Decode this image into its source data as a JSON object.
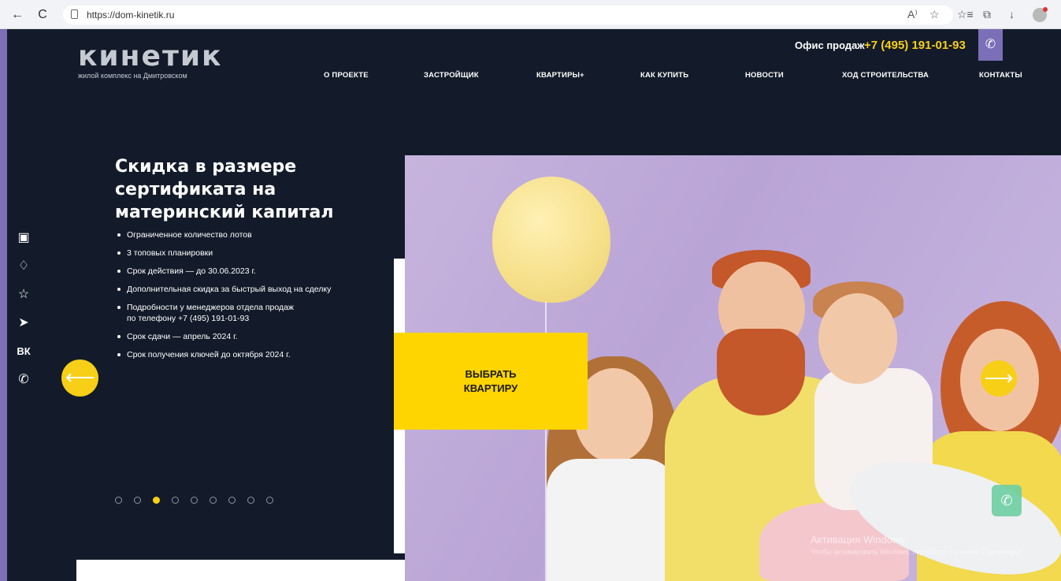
{
  "browser": {
    "back_icon": "←",
    "refresh_icon": "C",
    "url": "https://dom-kinetik.ru",
    "toolbar_icons": [
      "A⁾",
      "☆",
      "☆≡",
      "⧉",
      "↓"
    ]
  },
  "header": {
    "logo_word": "кинетик",
    "logo_subtitle": "жилой комплекс на Дмитровском",
    "office_label": "Офис продаж",
    "office_phone": "+7 (495) 191-01-93",
    "phone_icon": "✆"
  },
  "menu": [
    "О ПРОЕКТЕ",
    "ЗАСТРОЙЩИК",
    "КВАРТИРЫ+",
    "КАК КУПИТЬ",
    "НОВОСТИ",
    "ХОД СТРОИТЕЛЬСТВА",
    "КОНТАКТЫ"
  ],
  "side_icons": [
    "▣",
    "♢",
    "☆",
    "➤",
    "ВК",
    "✆"
  ],
  "slide": {
    "title": "Скидка в размере сертификата на материнский капитал",
    "features": [
      "Ограниченное количество лотов",
      "3 топовых планировки",
      "Срок действия — до 30.06.2023 г.",
      "Дополнительная скидка за быстрый выход на сделку",
      "Подробности у менеджеров отдела продаж\nпо телефону +7 (495) 191-01-93",
      "Срок сдачи — апрель 2024 г.",
      "Срок получения ключей до октября 2024 г."
    ],
    "cta": "ВЫБРАТЬ\nКВАРТИРУ",
    "arrow_left": "⟵",
    "arrow_right": "⟶",
    "dots_total": 9,
    "active_dot": 3
  },
  "overlay": {
    "call_icon": "✆",
    "watermark": "Активация Windows",
    "watermark_sub": "Чтобы активировать Windows, перейдите в раздел \"Параметры\"."
  }
}
